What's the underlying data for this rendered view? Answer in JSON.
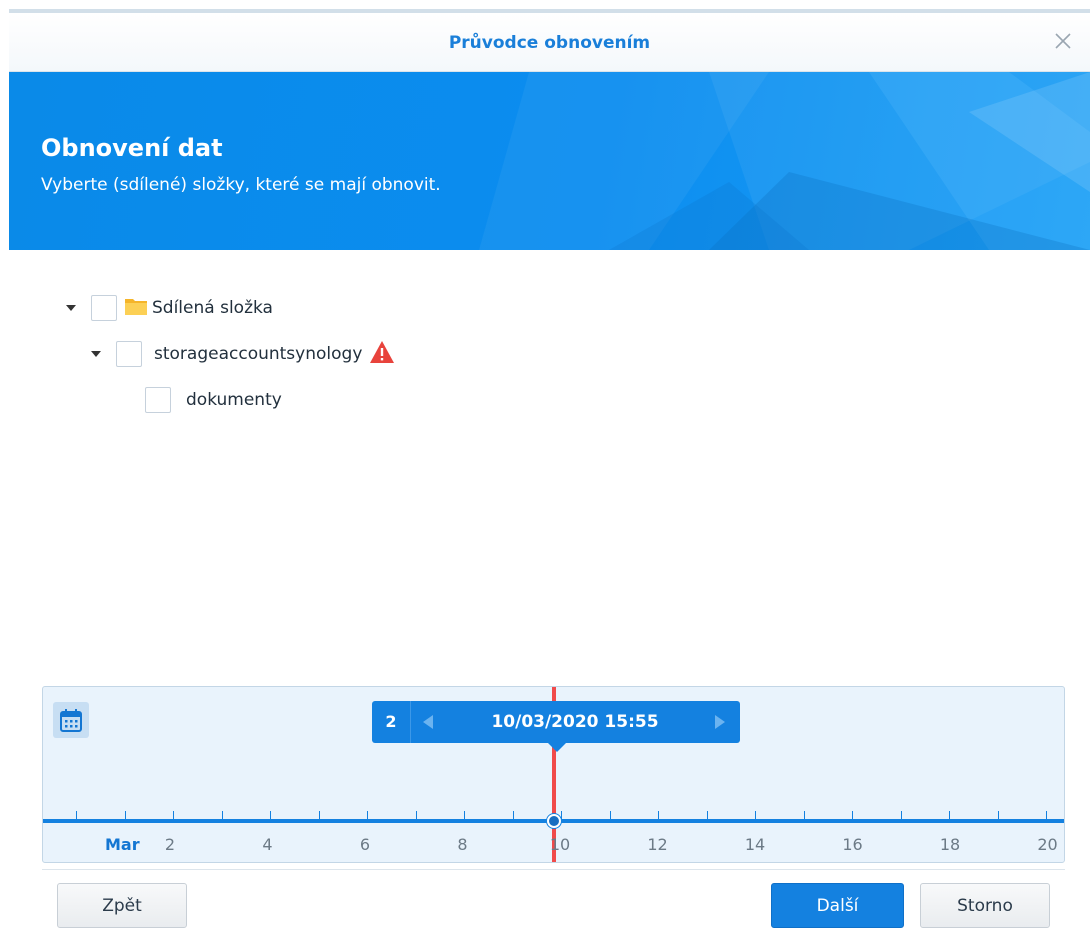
{
  "window": {
    "title": "Průvodce obnovením",
    "close_icon": "close-icon"
  },
  "banner": {
    "title": "Obnovení dat",
    "subtitle": "Vyberte (sdílené) složky, které se mají obnovit."
  },
  "tree": {
    "items": [
      {
        "label": "Sdílená složka",
        "checked": false,
        "expanded": true,
        "icon": "folder-icon"
      },
      {
        "label": "storageaccountsynology",
        "checked": false,
        "expanded": true,
        "icon": "warning-icon"
      },
      {
        "label": "dokumenty",
        "checked": false
      }
    ]
  },
  "timeline": {
    "calendar_icon": "calendar-icon",
    "version_count": "2",
    "selected_date": "10/03/2020 15:55",
    "month_label": "Mar",
    "day_labels": [
      "2",
      "4",
      "6",
      "8",
      "10",
      "12",
      "14",
      "16",
      "18",
      "20"
    ],
    "accent": "#1481e0",
    "marker_color": "#f04a4a"
  },
  "footer": {
    "back_label": "Zpět",
    "next_label": "Další",
    "cancel_label": "Storno"
  }
}
